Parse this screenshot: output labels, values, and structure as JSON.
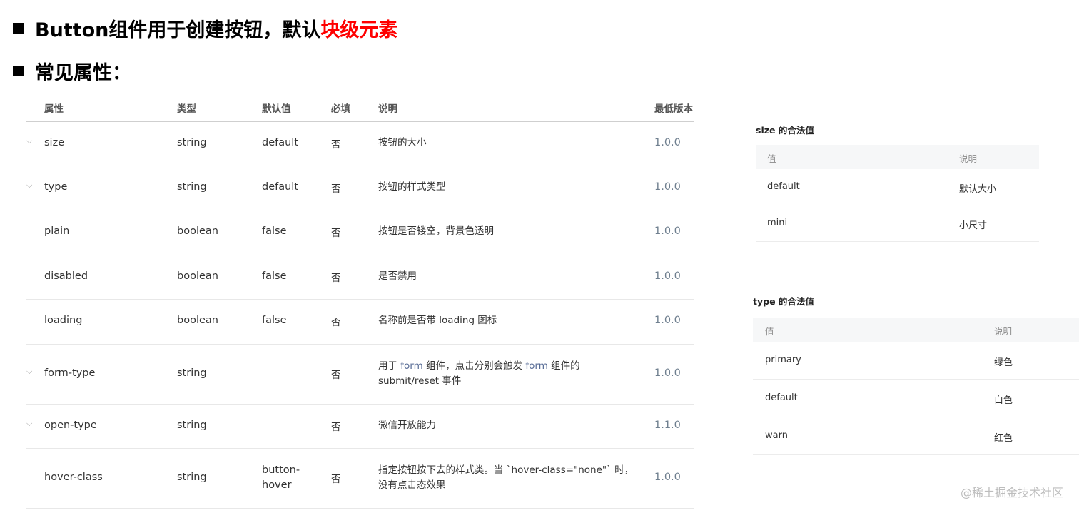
{
  "headings": {
    "h1_main": "Button组件用于创建按钮，默认",
    "h1_highlight": "块级元素",
    "h2": "常见属性："
  },
  "main_table": {
    "columns": [
      "属性",
      "类型",
      "默认值",
      "必填",
      "说明",
      "最低版本"
    ],
    "rows": [
      {
        "expand": "⌵",
        "name": "size",
        "type": "string",
        "default": "default",
        "required": "否",
        "desc": "按钮的大小",
        "version": "1.0.0"
      },
      {
        "expand": "⌵",
        "name": "type",
        "type": "string",
        "default": "default",
        "required": "否",
        "desc": "按钮的样式类型",
        "version": "1.0.0"
      },
      {
        "expand": "",
        "name": "plain",
        "type": "boolean",
        "default": "false",
        "required": "否",
        "desc": "按钮是否镂空，背景色透明",
        "version": "1.0.0"
      },
      {
        "expand": "",
        "name": "disabled",
        "type": "boolean",
        "default": "false",
        "required": "否",
        "desc": "是否禁用",
        "version": "1.0.0"
      },
      {
        "expand": "",
        "name": "loading",
        "type": "boolean",
        "default": "false",
        "required": "否",
        "desc": "名称前是否带 loading 图标",
        "version": "1.0.0"
      },
      {
        "expand": "⌵",
        "name": "form-type",
        "type": "string",
        "default": "",
        "required": "否",
        "desc_parts": [
          "用于 ",
          "form",
          " 组件，点击分别会触发 ",
          "form",
          " 组件的",
          "submit/reset 事件"
        ],
        "version": "1.0.0"
      },
      {
        "expand": "⌵",
        "name": "open-type",
        "type": "string",
        "default": "",
        "required": "否",
        "desc": "微信开放能力",
        "version": "1.1.0"
      },
      {
        "expand": "",
        "name": "hover-class",
        "type": "string",
        "default_lines": [
          "button-",
          "hover"
        ],
        "required": "否",
        "desc_lines": [
          "指定按钮按下去的样式类。当 `hover-class=\"none\"` 时，",
          "没有点击态效果"
        ],
        "version": "1.0.0"
      }
    ]
  },
  "size_table": {
    "title": "size 的合法值",
    "columns": [
      "值",
      "说明"
    ],
    "rows": [
      {
        "value": "default",
        "desc": "默认大小"
      },
      {
        "value": "mini",
        "desc": "小尺寸"
      }
    ]
  },
  "type_table": {
    "title": "type 的合法值",
    "columns": [
      "值",
      "说明"
    ],
    "rows": [
      {
        "value": "primary",
        "desc": "绿色"
      },
      {
        "value": "default",
        "desc": "白色"
      },
      {
        "value": "warn",
        "desc": "红色"
      }
    ]
  },
  "watermark": "@稀土掘金技术社区",
  "colors": {
    "highlight": "#ff0000",
    "link": "#576b95",
    "version": "#6f7f8f"
  }
}
